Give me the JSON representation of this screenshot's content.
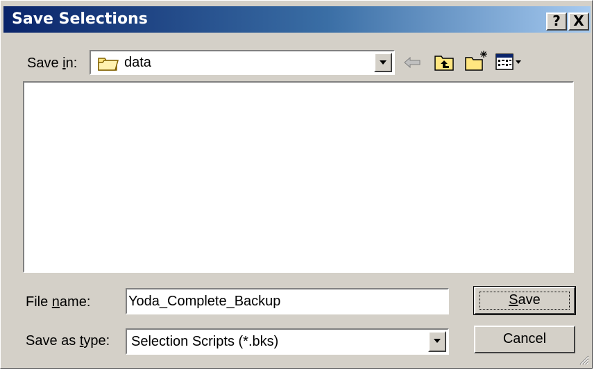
{
  "window": {
    "title": "Save Selections",
    "help_label": "?",
    "close_label": "X"
  },
  "save_in": {
    "label_prefix": "Save ",
    "label_accel": "i",
    "label_suffix": "n:",
    "value": "data",
    "icon": "folder-icon"
  },
  "toolbar": {
    "icons": [
      "back-arrow-icon",
      "up-one-level-icon",
      "create-new-folder-icon",
      "view-menu-icon"
    ]
  },
  "file_name": {
    "label_prefix": "File ",
    "label_accel": "n",
    "label_suffix": "ame:",
    "value": "Yoda_Complete_Backup"
  },
  "save_as_type": {
    "label_prefix": "Save as ",
    "label_accel": "t",
    "label_suffix": "ype:",
    "value": "Selection Scripts (*.bks)"
  },
  "buttons": {
    "save_accel": "S",
    "save_rest": "ave",
    "cancel": "Cancel"
  },
  "colors": {
    "titlebar_start": "#0a246a",
    "titlebar_end": "#a6caf0",
    "face": "#d4d0c8"
  }
}
